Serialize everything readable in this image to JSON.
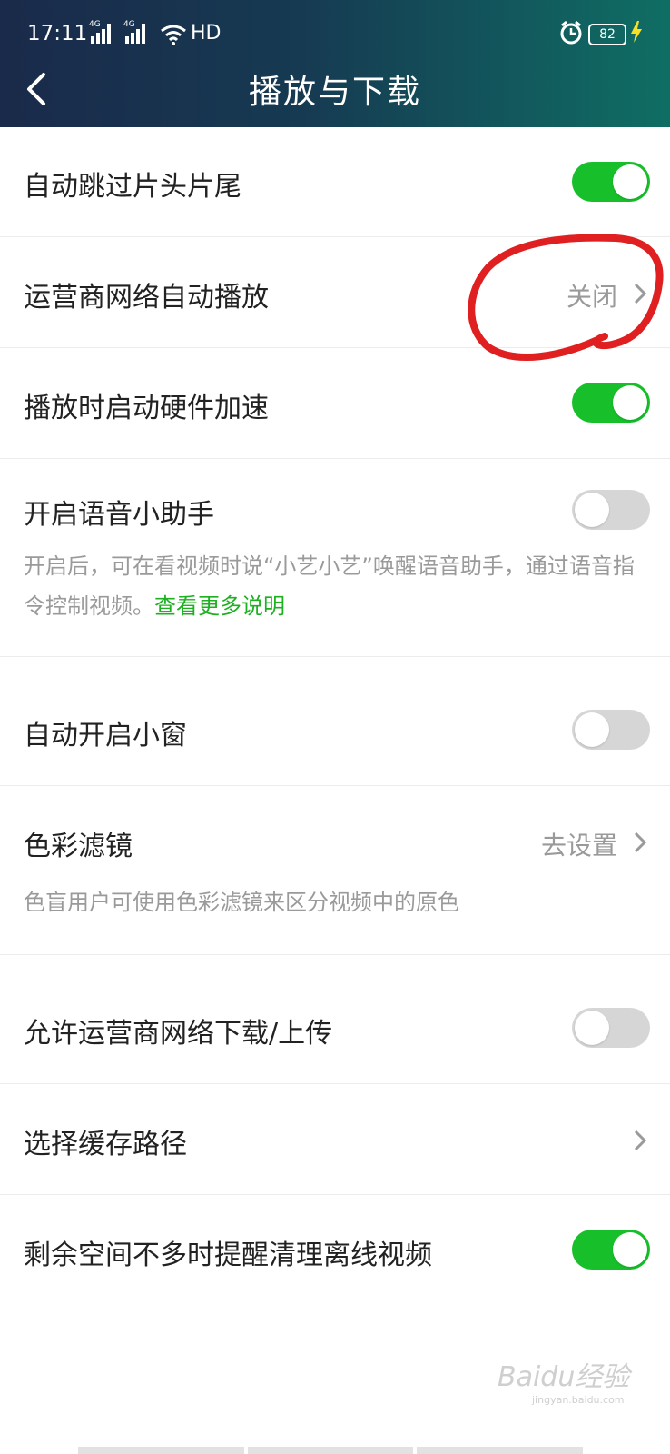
{
  "status_bar": {
    "time": "17:11",
    "network_1": "4G",
    "network_2": "4G",
    "hd": "HD",
    "battery": "82"
  },
  "header": {
    "title": "播放与下载"
  },
  "settings": [
    {
      "label": "自动跳过片头片尾",
      "type": "toggle",
      "state": "on"
    },
    {
      "label": "运营商网络自动播放",
      "type": "link",
      "value": "关闭"
    },
    {
      "label": "播放时启动硬件加速",
      "type": "toggle",
      "state": "on"
    },
    {
      "label": "开启语音小助手",
      "type": "toggle",
      "state": "off",
      "desc": "开启后，可在看视频时说“小艺小艺”唤醒语音助手，通过语音指令控制视频。",
      "desc_link": "查看更多说明"
    },
    {
      "label": "自动开启小窗",
      "type": "toggle",
      "state": "off"
    },
    {
      "label": "色彩滤镜",
      "type": "link",
      "value": "去设置",
      "desc": "色盲用户可使用色彩滤镜来区分视频中的原色"
    },
    {
      "label": "允许运营商网络下载/上传",
      "type": "toggle",
      "state": "off"
    },
    {
      "label": "选择缓存路径",
      "type": "link",
      "value": ""
    },
    {
      "label": "剩余空间不多时提醒清理离线视频",
      "type": "toggle",
      "state": "on"
    }
  ],
  "watermark": {
    "text": "Baidu经验",
    "sub": "jingyan.baidu.com"
  },
  "colors": {
    "accent_green": "#17bf2a",
    "link_green": "#1db021",
    "annotation_red": "#e02020"
  }
}
